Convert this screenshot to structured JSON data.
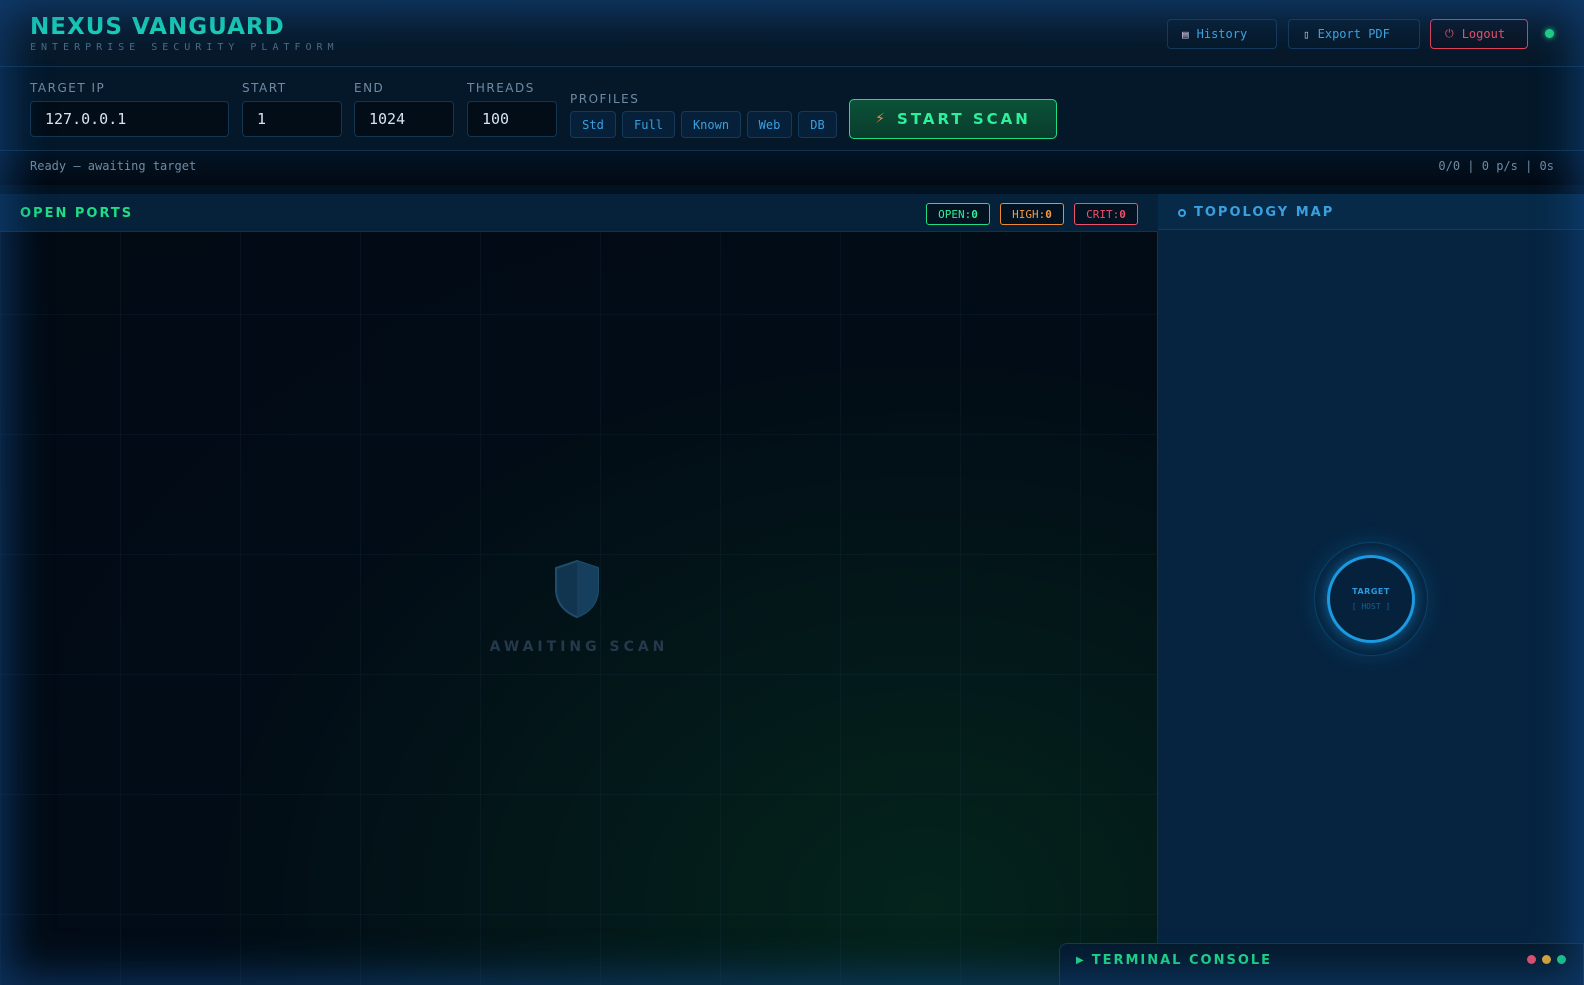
{
  "header": {
    "brand_title": "NEXUS VANGUARD",
    "brand_subtitle": "ENTERPRISE SECURITY PLATFORM",
    "buttons": {
      "history": "History",
      "export": "Export PDF",
      "logout": "Logout"
    },
    "icons": {
      "history": "clipboard-icon",
      "export": "document-icon",
      "logout": "power-icon"
    },
    "status_color": "#1fdc86"
  },
  "controls": {
    "target_ip": {
      "label": "TARGET IP",
      "value": "127.0.0.1"
    },
    "start": {
      "label": "START",
      "value": "1"
    },
    "end": {
      "label": "END",
      "value": "1024"
    },
    "threads": {
      "label": "THREADS",
      "value": "100"
    },
    "profiles_label": "PROFILES",
    "profiles": [
      "Std",
      "Full",
      "Known",
      "Web",
      "DB"
    ],
    "start_scan": "START SCAN"
  },
  "status": {
    "text": "Ready — awaiting target",
    "metrics": "0/0 | 0 p/s | 0s"
  },
  "ports": {
    "title": "OPEN PORTS",
    "badges": {
      "open_label": "OPEN:",
      "open_value": "0",
      "high_label": "HIGH:",
      "high_value": "0",
      "crit_label": "CRIT:",
      "crit_value": "0"
    },
    "empty_state": "AWAITING SCAN"
  },
  "topology": {
    "title": "TOPOLOGY MAP",
    "node_label": "TARGET",
    "node_sub": "[ HOST ]"
  },
  "terminal": {
    "title": "TERMINAL CONSOLE"
  },
  "colors": {
    "accent_green": "#1fdc86",
    "accent_blue": "#3aa0e0",
    "accent_orange": "#f08a30",
    "accent_red": "#f0506a"
  }
}
